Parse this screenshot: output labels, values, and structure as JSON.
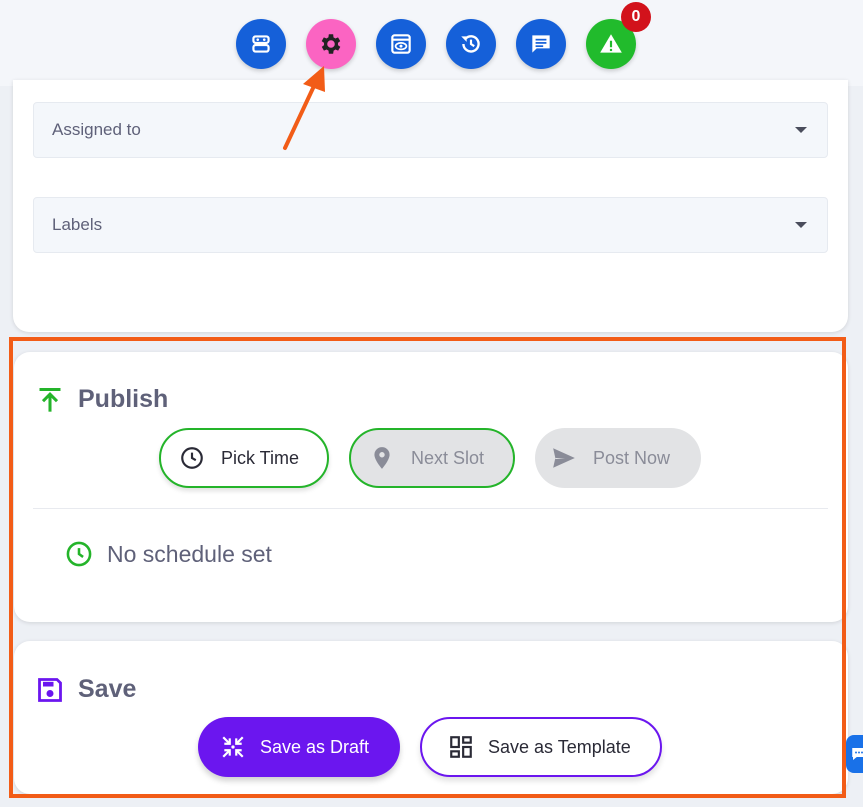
{
  "toolbar": {
    "buttons": [
      {
        "icon": "robot-icon",
        "color": "#1560d9"
      },
      {
        "icon": "gear-icon",
        "color": "#fb64c2"
      },
      {
        "icon": "preview-eye-icon",
        "color": "#1560d9"
      },
      {
        "icon": "history-icon",
        "color": "#1560d9"
      },
      {
        "icon": "comment-icon",
        "color": "#1560d9"
      },
      {
        "icon": "warning-icon",
        "color": "#21bb2c"
      }
    ],
    "alert_count": "0"
  },
  "fields": {
    "assigned_to": {
      "placeholder": "Assigned to"
    },
    "labels": {
      "placeholder": "Labels"
    }
  },
  "publish": {
    "title": "Publish",
    "pick_time": "Pick Time",
    "next_slot": "Next Slot",
    "post_now": "Post Now",
    "schedule_status": "No schedule set"
  },
  "save": {
    "title": "Save",
    "save_draft": "Save as Draft",
    "save_template": "Save as Template"
  },
  "colors": {
    "accent_orange": "#f25c17",
    "primary_blue": "#1560d9",
    "purple": "#6b16ef",
    "green": "#24b42a",
    "badge_red": "#d2121b"
  }
}
